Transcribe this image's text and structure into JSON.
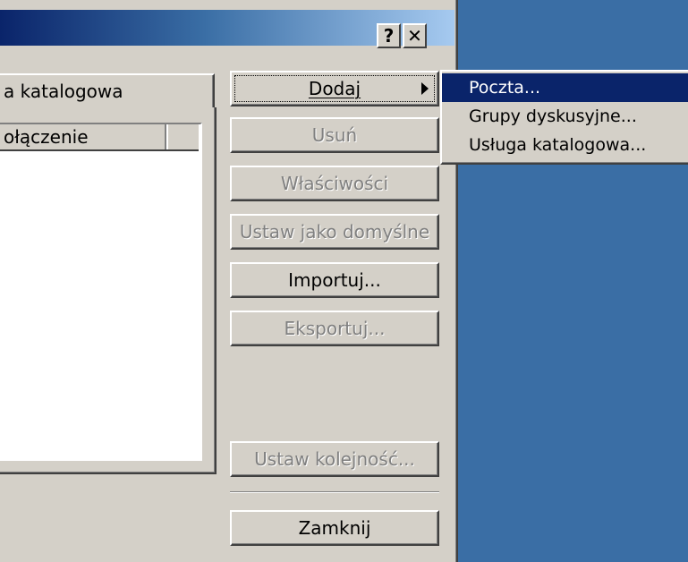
{
  "title_buttons": {
    "help": "?",
    "close": "✕"
  },
  "tab": {
    "label": "a katalogowa"
  },
  "list": {
    "column1": "ołączenie"
  },
  "buttons": {
    "add": "Dodaj",
    "remove": "Usuń",
    "properties": "Właściwości",
    "set_default": "Ustaw jako domyślne",
    "import": "Importuj...",
    "export": "Eksportuj...",
    "set_order": "Ustaw kolejność...",
    "close": "Zamknij"
  },
  "menu": {
    "items": [
      {
        "label": "Poczta..."
      },
      {
        "label": "Grupy dyskusyjne..."
      },
      {
        "label": "Usługa katalogowa..."
      }
    ],
    "selected_index": 0
  },
  "colors": {
    "desktop": "#3a6ea5",
    "face": "#d4d0c8",
    "highlight": "#0a246a"
  }
}
